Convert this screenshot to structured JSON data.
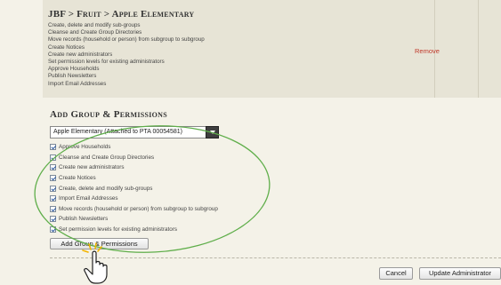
{
  "existing_group": {
    "breadcrumb": "JBF > Fruit > Apple Elementary",
    "permissions": [
      "Create, delete and modify sub-groups",
      "Cleanse and Create Group Directories",
      "Move records (household or person) from subgroup to subgroup",
      "Create Notices",
      "Create new administrators",
      "Set permission levels for existing administrators",
      "Approve Households",
      "Publish Newsletters",
      "Import Email Addresses"
    ],
    "remove_label": "Remove"
  },
  "add_section": {
    "title": "Add Group & Permissions",
    "group_select_value": "Apple Elementary (Attached to PTA 00054581)",
    "options": [
      {
        "label": "Approve Households",
        "checked": true
      },
      {
        "label": "Cleanse and Create Group Directories",
        "checked": true
      },
      {
        "label": "Create new administrators",
        "checked": true
      },
      {
        "label": "Create Notices",
        "checked": true
      },
      {
        "label": "Create, delete and modify sub-groups",
        "checked": true
      },
      {
        "label": "Import Email Addresses",
        "checked": true
      },
      {
        "label": "Move records (household or person) from subgroup to subgroup",
        "checked": true
      },
      {
        "label": "Publish Newsletters",
        "checked": true
      },
      {
        "label": "Set permission levels for existing administrators",
        "checked": true
      }
    ],
    "add_button_label": "Add Group & Permissions"
  },
  "footer": {
    "cancel_label": "Cancel",
    "update_label": "Update Administrator"
  },
  "colors": {
    "highlight": "#5fae4a",
    "remove": "#c0392b"
  },
  "icons": {
    "cursor": "hand-pointer-icon",
    "dropdown": "chevron-down-icon"
  }
}
